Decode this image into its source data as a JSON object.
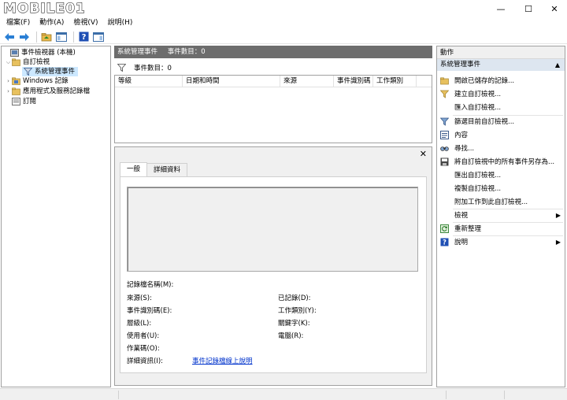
{
  "window": {
    "logo_text": "MOBILE01",
    "minimize_glyph": "—",
    "maximize_glyph": "☐",
    "close_glyph": "✕"
  },
  "menu": [
    "檔案(F)",
    "動作(A)",
    "檢視(V)",
    "說明(H)"
  ],
  "tree": {
    "root": "事件檢視器 (本機)",
    "custom_views": "自訂檢視",
    "admin_events": "系統管理事件",
    "windows_logs": "Windows 記錄",
    "app_logs": "應用程式及服務記錄檔",
    "subscriptions": "訂閱"
  },
  "center": {
    "header_title": "系統管理事件",
    "header_count": "事件數目：0",
    "filter_count": "事件數目：0",
    "columns": [
      "等級",
      "日期和時間",
      "來源",
      "事件識別碼",
      "工作類別"
    ]
  },
  "detail": {
    "close_glyph": "✕",
    "tabs": [
      "一般",
      "詳細資料"
    ],
    "fields": {
      "log_name": "記錄檔名稱(M):",
      "source": "來源(S):",
      "logged": "已記錄(D):",
      "event_id": "事件識別碼(E):",
      "task_category": "工作類別(Y):",
      "level": "層級(L):",
      "keywords": "關鍵字(K):",
      "user": "使用者(U):",
      "computer": "電腦(R):",
      "opcode": "作業碼(O):",
      "more_info": "詳細資訊(I):",
      "more_info_link": "事件記錄檔線上說明"
    }
  },
  "actions": {
    "header": "動作",
    "section": "系統管理事件",
    "collapse_glyph": "▲",
    "submenu_glyph": "▶",
    "items": [
      "開啟已儲存的記錄...",
      "建立自訂檢視...",
      "匯入自訂檢視...",
      "篩選目前自訂檢視...",
      "內容",
      "尋找...",
      "將自訂檢視中的所有事件另存為...",
      "匯出自訂檢視...",
      "複製自訂檢視...",
      "附加工作到此自訂檢視...",
      "檢視",
      "重新整理",
      "說明"
    ]
  },
  "colors": {
    "header_gray": "#6d6d6d",
    "selection": "#cce8ff",
    "section_blue": "#dde6f0",
    "link": "#0033cc"
  }
}
